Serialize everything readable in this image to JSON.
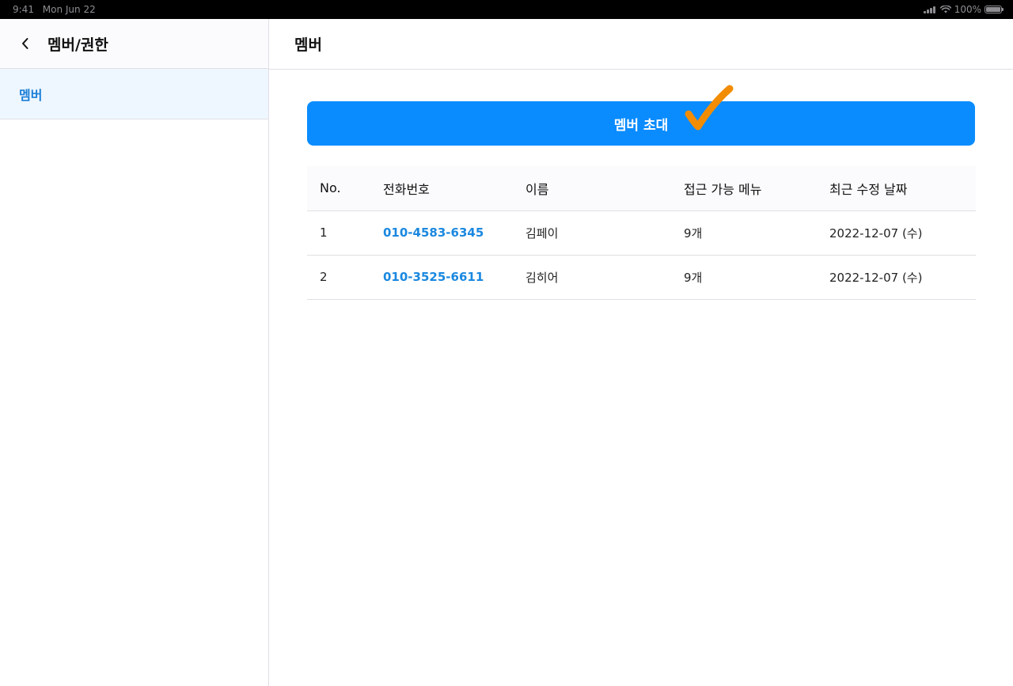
{
  "status_bar": {
    "time": "9:41",
    "date": "Mon Jun 22",
    "battery_pct": "100%",
    "icons": [
      "signal-icon",
      "wifi-icon",
      "battery-icon"
    ]
  },
  "sidebar": {
    "title": "멤버/권한",
    "back_icon": "chevron-left-icon",
    "items": [
      {
        "label": "멤버",
        "active": true
      }
    ]
  },
  "main": {
    "title": "멤버",
    "invite_button": "멤버 초대",
    "annotation_icon": "checkmark-icon",
    "table": {
      "headers": [
        "No.",
        "전화번호",
        "이름",
        "접근 가능 메뉴",
        "최근 수정 날짜"
      ],
      "rows": [
        [
          "1",
          "010-4583-6345",
          "김페이",
          "9개",
          "2022-12-07 (수)"
        ],
        [
          "2",
          "010-3525-6611",
          "김히어",
          "9개",
          "2022-12-07 (수)"
        ]
      ]
    }
  },
  "colors": {
    "accent": "#0a8cff",
    "link": "#1a88e0",
    "active_bg": "#eef6ff",
    "annotation": "#f28c00"
  }
}
